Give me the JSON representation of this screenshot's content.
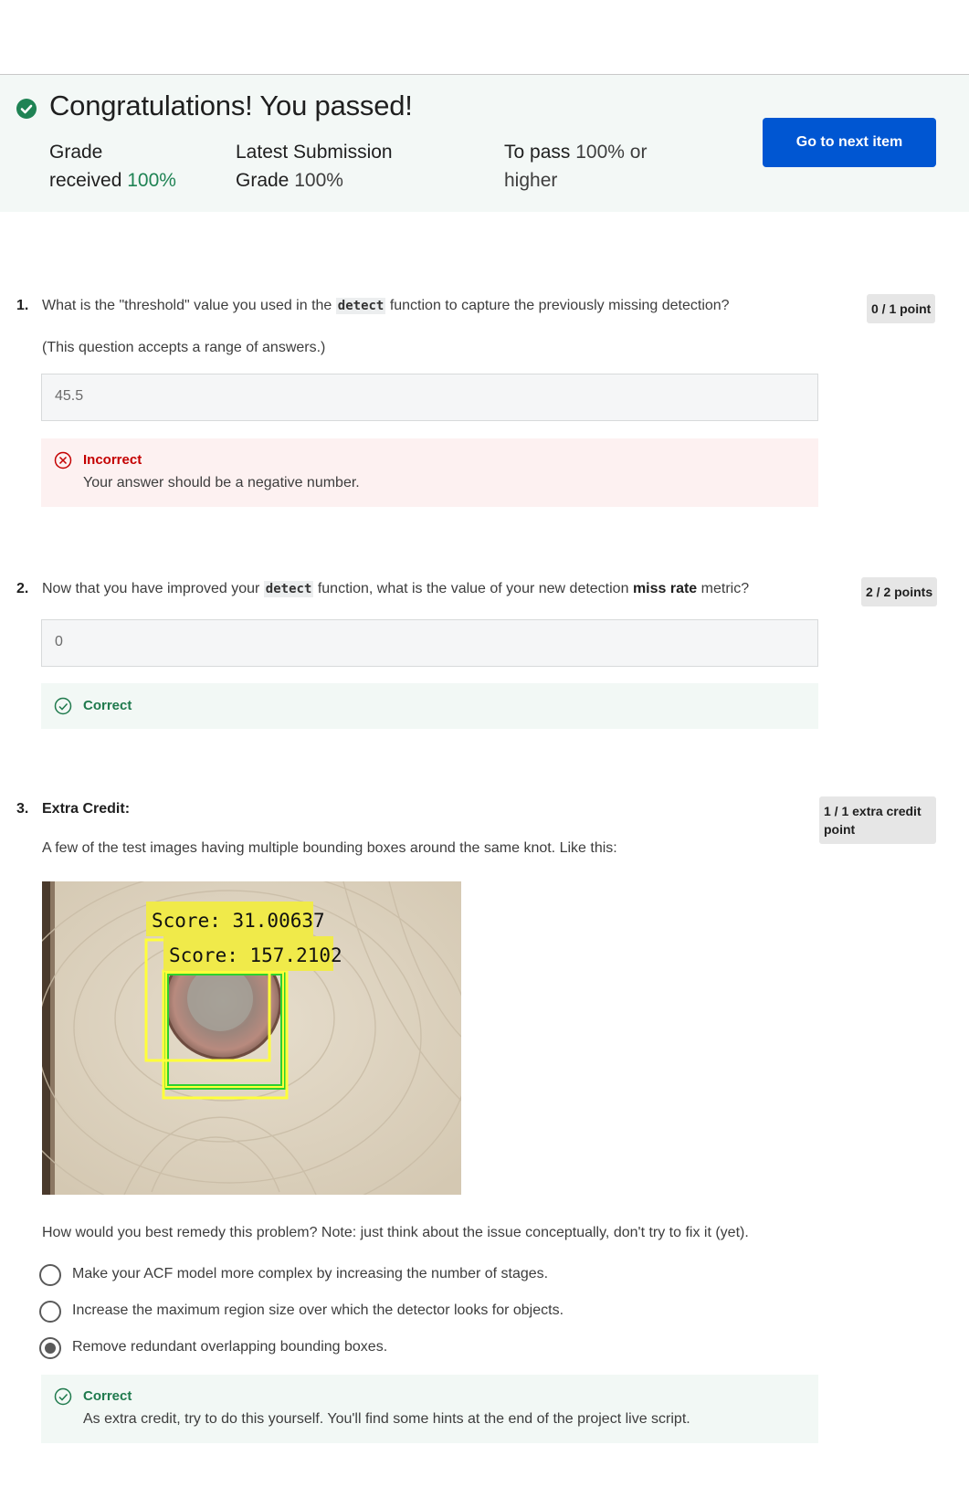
{
  "header": {
    "title": "Congratulations! You passed!",
    "grade_received_label_1": "Grade",
    "grade_received_label_2": "received",
    "grade_received_value": "100%",
    "latest_label_1": "Latest Submission",
    "latest_label_2": "Grade",
    "latest_value": "100%",
    "to_pass_label": "To pass",
    "to_pass_value": "100% or",
    "to_pass_value_2": "higher",
    "next_button": "Go to next item"
  },
  "q1": {
    "number": "1.",
    "text_before": "What is the \"threshold\" value you used in the",
    "code": "detect",
    "text_after": "function to capture the previously missing detection?",
    "note": "(This question accepts a range of answers.)",
    "answer": "45.5",
    "points": "0 / 1 point",
    "feedback_title": "Incorrect",
    "feedback_msg": "Your answer should be a negative number."
  },
  "q2": {
    "number": "2.",
    "text_before": "Now that you have improved your",
    "code": "detect",
    "text_middle": "function, what is the value of your new detection",
    "text_bold": "miss rate",
    "text_after": "metric?",
    "answer": "0",
    "points": "2 / 2 points",
    "feedback_title": "Correct"
  },
  "q3": {
    "number": "3.",
    "title": "Extra Credit:",
    "points_line1": "1 / 1 extra credit",
    "points_line2": "point",
    "intro": "A few of the test images having multiple bounding boxes around the same knot. Like this:",
    "image": {
      "score_1": "Score: 31.00637",
      "score_2": "Score: 157.2102"
    },
    "question": "How would you best remedy this problem? Note: just think about the issue conceptually, don't try to fix it (yet).",
    "options": [
      "Make your ACF model more complex by increasing the number of stages.",
      "Increase the maximum region size over which the detector looks for objects.",
      "Remove redundant overlapping bounding boxes."
    ],
    "selected_option": 2,
    "feedback_title": "Correct",
    "feedback_msg": "As extra credit, try to do this yourself. You'll find some hints at the end of the project live script."
  },
  "colors": {
    "brand_blue": "#0056d2",
    "success_green": "#1f8354",
    "error_red": "#c40000"
  }
}
